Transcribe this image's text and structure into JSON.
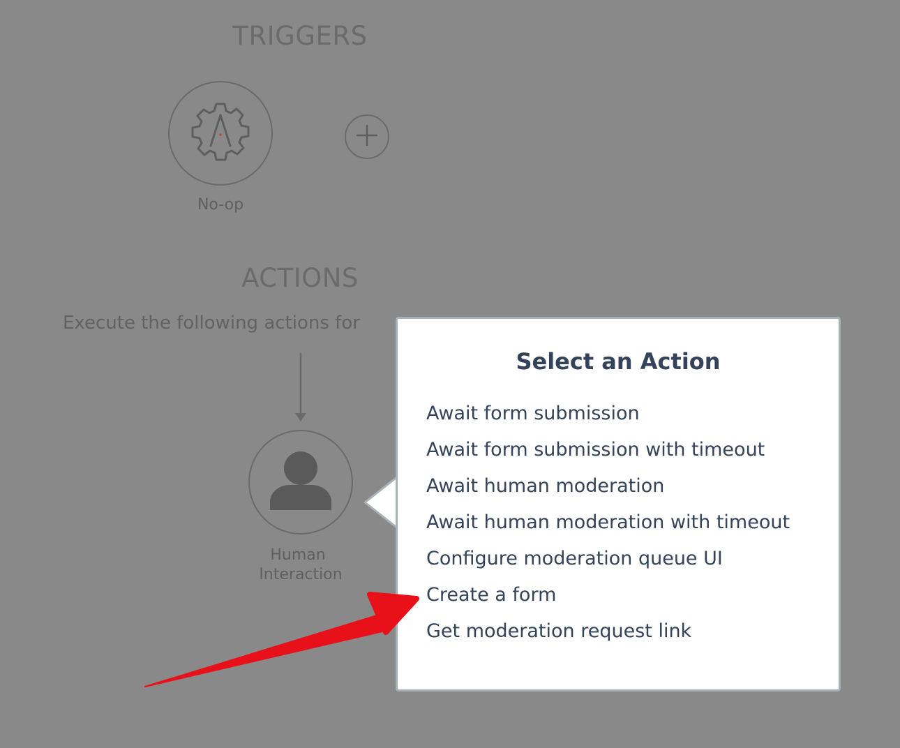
{
  "triggers": {
    "section_title": "TRIGGERS",
    "node": {
      "label": "No-op",
      "icon": "gear-icon"
    },
    "add_button": {
      "icon": "plus-icon"
    }
  },
  "actions": {
    "section_title": "ACTIONS",
    "description": "Execute the following actions for",
    "node": {
      "label_line1": "Human",
      "label_line2": "Interaction",
      "icon": "person-icon"
    }
  },
  "popover": {
    "title": "Select an Action",
    "items": [
      {
        "label": "Await form submission"
      },
      {
        "label": "Await form submission with timeout"
      },
      {
        "label": "Await human moderation"
      },
      {
        "label": "Await human moderation with timeout"
      },
      {
        "label": "Configure moderation queue UI"
      },
      {
        "label": "Create a form"
      },
      {
        "label": "Get moderation request link"
      }
    ]
  },
  "annotation": {
    "icon": "red-arrow-icon",
    "color": "#e8111a"
  },
  "colors": {
    "backdrop": "#898989",
    "popover_text": "#34435a",
    "popover_border": "#a9b1b6",
    "gear_accent": "#b5473a"
  }
}
